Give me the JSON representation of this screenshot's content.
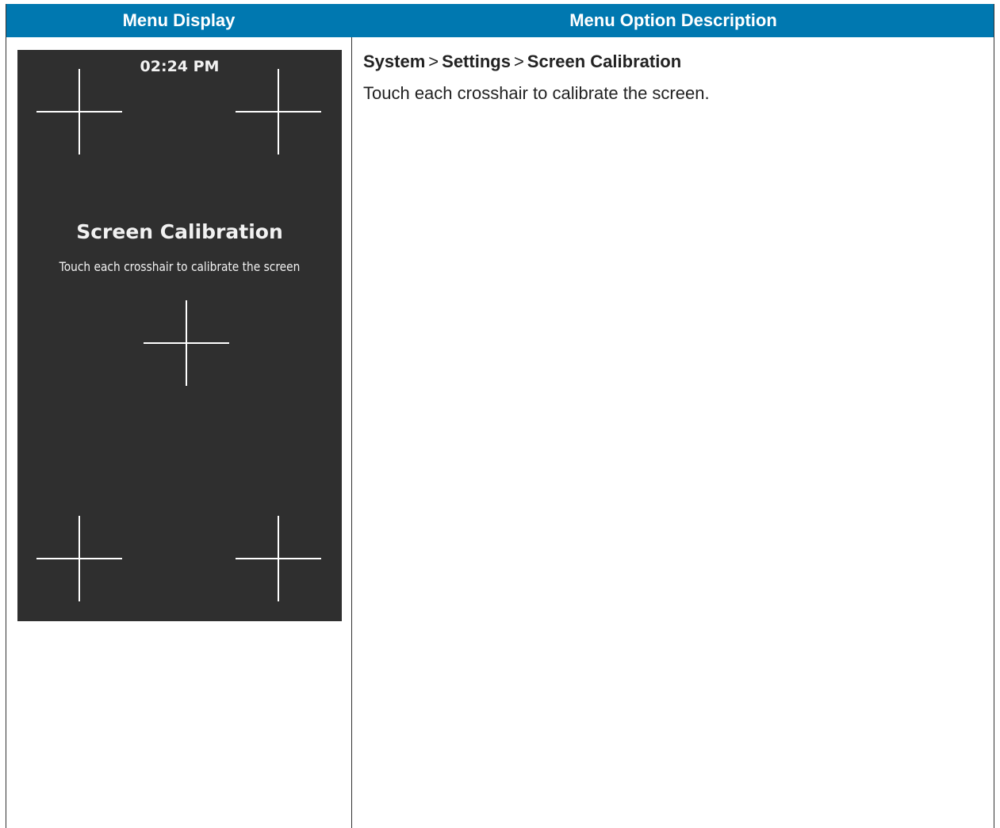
{
  "header": {
    "col1": "Menu Display",
    "col2": "Menu Option Description"
  },
  "screen": {
    "time": "02:24 PM",
    "title": "Screen Calibration",
    "subtitle": "Touch each crosshair to calibrate the screen"
  },
  "description": {
    "path": [
      "System",
      "Settings",
      "Screen Calibration"
    ],
    "separator": ">",
    "text": "Touch each crosshair to calibrate the screen."
  },
  "colors": {
    "header_bg": "#0078b0",
    "screen_bg": "#2f2f2f"
  }
}
